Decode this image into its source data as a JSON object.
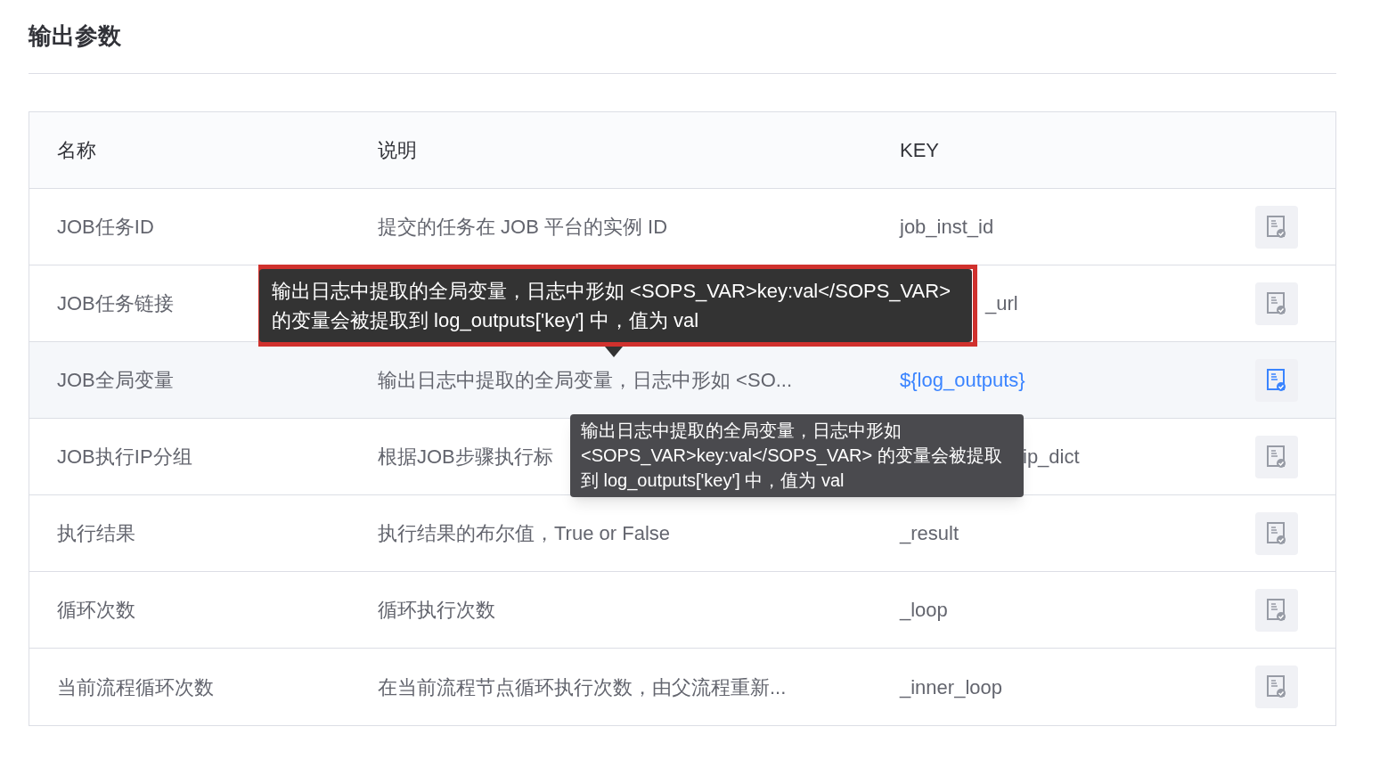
{
  "section_title": "输出参数",
  "table": {
    "columns": [
      "名称",
      "说明",
      "KEY"
    ],
    "rows": [
      {
        "name": "JOB任务ID",
        "description": "提交的任务在 JOB 平台的实例 ID",
        "key": "job_inst_id",
        "kind": "plain",
        "active": false
      },
      {
        "name": "JOB任务链接",
        "key": "_url",
        "kind": "covered",
        "active": false
      },
      {
        "name": "JOB全局变量",
        "description": "输出日志中提取的全局变量，日志中形如 <SO...",
        "key": "${log_outputs}",
        "kind": "plain",
        "active": true
      },
      {
        "name": "JOB执行IP分组",
        "description": "根据JOB步骤执行标",
        "key": "ip_dict",
        "kind": "covered_wide",
        "active": false
      },
      {
        "name": "执行结果",
        "description": "执行结果的布尔值，True or False",
        "key": "_result",
        "kind": "plain",
        "active": false
      },
      {
        "name": "循环次数",
        "description": "循环执行次数",
        "key": "_loop",
        "kind": "plain",
        "active": false
      },
      {
        "name": "当前流程循环次数",
        "description": "在当前流程节点循环执行次数，由父流程重新...",
        "key": "_inner_loop",
        "kind": "plain",
        "active": false
      }
    ]
  },
  "tooltips": [
    {
      "text": "输出日志中提取的全局变量，日志中形如 <SOPS_VAR>key:val</SOPS_VAR> 的变量会被提取到 log_outputs['key'] 中，值为 val",
      "highlighted": true,
      "arrow": true
    },
    {
      "text": "输出日志中提取的全局变量，日志中形如 <SOPS_VAR>key:val</SOPS_VAR> 的变量会被提取到 log_outputs['key'] 中，值为 val",
      "highlighted": false,
      "arrow": false
    }
  ]
}
